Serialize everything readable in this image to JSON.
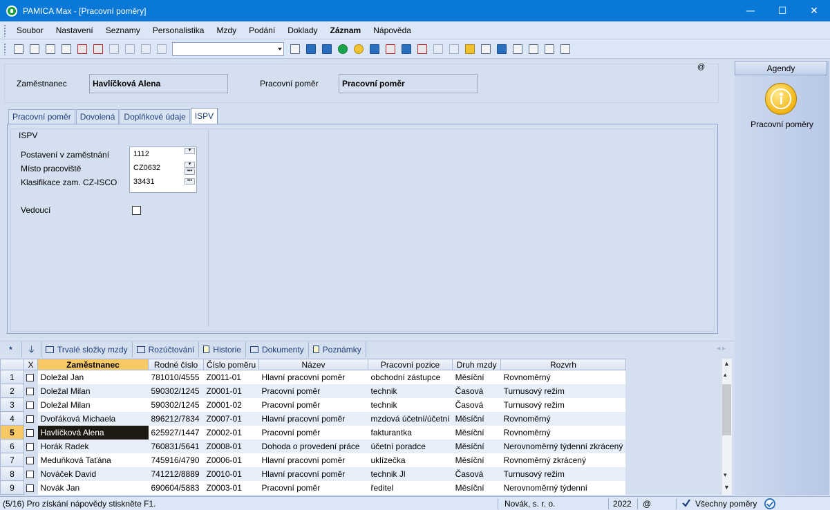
{
  "window": {
    "title": "PAMICA Max - [Pracovní poměry]",
    "minimize": "—",
    "maximize": "☐",
    "close": "✕"
  },
  "menu": [
    "Soubor",
    "Nastavení",
    "Seznamy",
    "Personalistika",
    "Mzdy",
    "Podání",
    "Doklady",
    "Záznam",
    "Nápověda"
  ],
  "header": {
    "employee_label": "Zaměstnanec",
    "employee_value": "Havlíčková Alena",
    "relation_label": "Pracovní poměr",
    "relation_value": "Pracovní poměr",
    "at_mark": "@"
  },
  "tabs": [
    "Pracovní poměr",
    "Dovolená",
    "Doplňkové údaje",
    "ISPV"
  ],
  "active_tab": "ISPV",
  "ispv": {
    "group_title": "ISPV",
    "status_label": "Postavení v zaměstnání",
    "status_value": "1112",
    "workplace_label": "Místo pracoviště",
    "workplace_value": "CZ0632",
    "isco_label": "Klasifikace zam. CZ-ISCO",
    "isco_value": "33431",
    "manager_label": "Vedoucí"
  },
  "sidebar": {
    "header": "Agendy",
    "item_label": "Pracovní poměry",
    "icon": "accessibility-person-icon"
  },
  "bottom_tabs": [
    "Trvalé složky mzdy",
    "Rozúčtování",
    "Historie",
    "Dokumenty",
    "Poznámky"
  ],
  "grid": {
    "columns": [
      "X",
      "Zaměstnanec",
      "Rodné číslo",
      "Číslo poměru",
      "Název",
      "Pracovní pozice",
      "Druh mzdy",
      "Rozvrh"
    ],
    "rows": [
      {
        "n": "1",
        "name": "Doležal Jan",
        "rc": "781010/4555",
        "cp": "Z0011-01",
        "nazev": "Hlavní pracovní poměr",
        "pozice": "obchodní zástupce",
        "druh": "Měsíční",
        "rozvrh": "Rovnoměrný"
      },
      {
        "n": "2",
        "name": "Doležal Milan",
        "rc": "590302/1245",
        "cp": "Z0001-01",
        "nazev": "Pracovní poměr",
        "pozice": "technik",
        "druh": "Časová",
        "rozvrh": "Turnusový režim"
      },
      {
        "n": "3",
        "name": "Doležal Milan",
        "rc": "590302/1245",
        "cp": "Z0001-02",
        "nazev": "Pracovní poměr",
        "pozice": "technik",
        "druh": "Časová",
        "rozvrh": "Turnusový režim"
      },
      {
        "n": "4",
        "name": "Dvořáková Michaela",
        "rc": "896212/7834",
        "cp": "Z0007-01",
        "nazev": "Hlavní pracovní poměr",
        "pozice": "mzdová účetní/účetní",
        "druh": "Měsíční",
        "rozvrh": "Rovnoměrný"
      },
      {
        "n": "5",
        "name": "Havlíčková Alena",
        "rc": "625927/1447",
        "cp": "Z0002-01",
        "nazev": "Pracovní poměr",
        "pozice": "fakturantka",
        "druh": "Měsíční",
        "rozvrh": "Rovnoměrný"
      },
      {
        "n": "6",
        "name": "Horák Radek",
        "rc": "760831/5641",
        "cp": "Z0008-01",
        "nazev": "Dohoda o provedení práce",
        "pozice": "účetní poradce",
        "druh": "Měsíční",
        "rozvrh": "Nerovnoměrný týdenní zkrácený"
      },
      {
        "n": "7",
        "name": "Meduňková Taťána",
        "rc": "745916/4790",
        "cp": "Z0006-01",
        "nazev": "Hlavní pracovní poměr",
        "pozice": "uklízečka",
        "druh": "Měsíční",
        "rozvrh": "Rovnoměrný zkrácený"
      },
      {
        "n": "8",
        "name": "Nováček David",
        "rc": "741212/8889",
        "cp": "Z0010-01",
        "nazev": "Hlavní pracovní poměr",
        "pozice": "technik Jl",
        "druh": "Časová",
        "rozvrh": "Turnusový režim"
      },
      {
        "n": "9",
        "name": "Novák Jan",
        "rc": "690604/5883",
        "cp": "Z0003-01",
        "nazev": "Pracovní poměr",
        "pozice": "ředitel",
        "druh": "Měsíční",
        "rozvrh": "Nerovnoměrný týdenní"
      }
    ],
    "selected_row": "5"
  },
  "status": {
    "help": "(5/16) Pro získání nápovědy stiskněte F1.",
    "company": "Novák, s. r. o.",
    "year": "2022",
    "at": "@",
    "filter": "Všechny poměry"
  }
}
